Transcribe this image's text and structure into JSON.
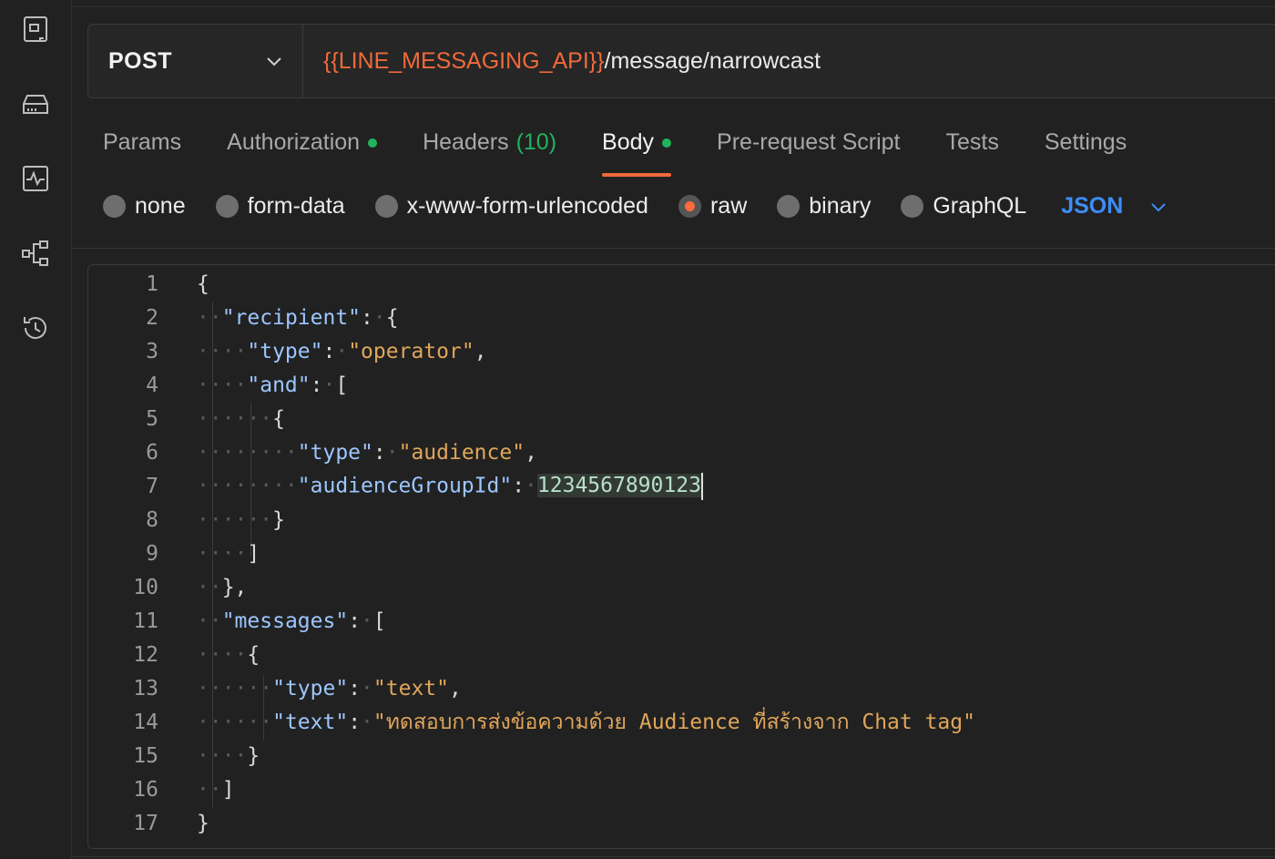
{
  "rail": {
    "icons": [
      "collections-icon",
      "environments-icon",
      "monitors-icon",
      "flows-icon",
      "history-icon"
    ]
  },
  "request": {
    "method": "POST",
    "url_variable": "{{LINE_MESSAGING_API}}",
    "url_path": "/message/narrowcast"
  },
  "tabs": {
    "params": "Params",
    "authorization": "Authorization",
    "headers": "Headers",
    "headers_count": "(10)",
    "body": "Body",
    "prerequest": "Pre-request Script",
    "tests": "Tests",
    "settings": "Settings",
    "active": "Body"
  },
  "body_types": {
    "none": "none",
    "form_data": "form-data",
    "urlencoded": "x-www-form-urlencoded",
    "raw": "raw",
    "binary": "binary",
    "graphql": "GraphQL",
    "selected": "raw",
    "format": "JSON"
  },
  "colors": {
    "accent": "#f06a3a",
    "status_green": "#1fb35b",
    "format_blue": "#3d8df5"
  },
  "editor": {
    "line_numbers": [
      "1",
      "2",
      "3",
      "4",
      "5",
      "6",
      "7",
      "8",
      "9",
      "10",
      "11",
      "12",
      "13",
      "14",
      "15",
      "16",
      "17"
    ],
    "lines": [
      "{",
      "\"recipient\": {",
      "\"type\": \"operator\",",
      "\"and\": [",
      "{",
      "\"type\": \"audience\",",
      "\"audienceGroupId\": 1234567890123",
      "}",
      "]",
      "},",
      "\"messages\": [",
      "{",
      "\"type\": \"text\",",
      "\"text\": \"ทดสอบการส่งข้อความด้วย Audience ที่สร้างจาก Chat tag\"",
      "}",
      "]",
      "}"
    ],
    "tokens": {
      "recipient_key": "\"recipient\"",
      "type_key": "\"type\"",
      "operator_val": "\"operator\"",
      "and_key": "\"and\"",
      "audience_val": "\"audience\"",
      "audience_group_key": "\"audienceGroupId\"",
      "audience_group_val": "1234567890123",
      "messages_key": "\"messages\"",
      "text_val": "\"text\"",
      "text_key": "\"text\"",
      "message_val": "\"ทดสอบการส่งข้อความด้วย Audience ที่สร้างจาก Chat tag\""
    }
  }
}
